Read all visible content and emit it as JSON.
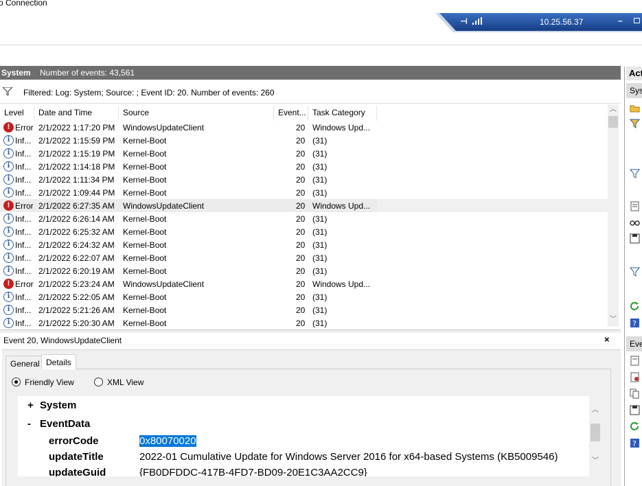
{
  "window": {
    "title": "o Connection"
  },
  "rdp_bar": {
    "ip": "10.25.56.37",
    "pin_icon": "pin-icon",
    "signal_icon": "signal-icon",
    "min_label": "–"
  },
  "log_pane": {
    "log_name": "System",
    "event_count": "Number of events: 43,561",
    "filter_text": "Filtered: Log: System; Source: ; Event ID: 20. Number of events: 260"
  },
  "columns": [
    "Level",
    "Date and Time",
    "Source",
    "Event...",
    "Task Category"
  ],
  "events": [
    {
      "level": "Error",
      "icon": "error",
      "datetime": "2/1/2022 1:17:20 PM",
      "source": "WindowsUpdateClient",
      "event_id": "20",
      "category": "Windows Upd..."
    },
    {
      "level": "Inf...",
      "icon": "info",
      "datetime": "2/1/2022 1:15:59 PM",
      "source": "Kernel-Boot",
      "event_id": "20",
      "category": "(31)"
    },
    {
      "level": "Inf...",
      "icon": "info",
      "datetime": "2/1/2022 1:15:19 PM",
      "source": "Kernel-Boot",
      "event_id": "20",
      "category": "(31)"
    },
    {
      "level": "Inf...",
      "icon": "info",
      "datetime": "2/1/2022 1:14:18 PM",
      "source": "Kernel-Boot",
      "event_id": "20",
      "category": "(31)"
    },
    {
      "level": "Inf...",
      "icon": "info",
      "datetime": "2/1/2022 1:11:34 PM",
      "source": "Kernel-Boot",
      "event_id": "20",
      "category": "(31)"
    },
    {
      "level": "Inf...",
      "icon": "info",
      "datetime": "2/1/2022 1:09:44 PM",
      "source": "Kernel-Boot",
      "event_id": "20",
      "category": "(31)"
    },
    {
      "level": "Error",
      "icon": "error",
      "datetime": "2/1/2022 6:27:35 AM",
      "source": "WindowsUpdateClient",
      "event_id": "20",
      "category": "Windows Upd...",
      "selected": true
    },
    {
      "level": "Inf...",
      "icon": "info",
      "datetime": "2/1/2022 6:26:14 AM",
      "source": "Kernel-Boot",
      "event_id": "20",
      "category": "(31)"
    },
    {
      "level": "Inf...",
      "icon": "info",
      "datetime": "2/1/2022 6:25:32 AM",
      "source": "Kernel-Boot",
      "event_id": "20",
      "category": "(31)"
    },
    {
      "level": "Inf...",
      "icon": "info",
      "datetime": "2/1/2022 6:24:32 AM",
      "source": "Kernel-Boot",
      "event_id": "20",
      "category": "(31)"
    },
    {
      "level": "Inf...",
      "icon": "info",
      "datetime": "2/1/2022 6:22:07 AM",
      "source": "Kernel-Boot",
      "event_id": "20",
      "category": "(31)"
    },
    {
      "level": "Inf...",
      "icon": "info",
      "datetime": "2/1/2022 6:20:19 AM",
      "source": "Kernel-Boot",
      "event_id": "20",
      "category": "(31)"
    },
    {
      "level": "Error",
      "icon": "error",
      "datetime": "2/1/2022 5:23:24 AM",
      "source": "WindowsUpdateClient",
      "event_id": "20",
      "category": "Windows Upd..."
    },
    {
      "level": "Inf...",
      "icon": "info",
      "datetime": "2/1/2022 5:22:05 AM",
      "source": "Kernel-Boot",
      "event_id": "20",
      "category": "(31)"
    },
    {
      "level": "Inf...",
      "icon": "info",
      "datetime": "2/1/2022 5:21:26 AM",
      "source": "Kernel-Boot",
      "event_id": "20",
      "category": "(31)"
    },
    {
      "level": "Inf...",
      "icon": "info",
      "datetime": "2/1/2022 5:20:30 AM",
      "source": "Kernel-Boot",
      "event_id": "20",
      "category": "(31)"
    }
  ],
  "detail": {
    "title": "Event 20, WindowsUpdateClient",
    "close_label": "×",
    "tabs": [
      "General",
      "Details"
    ],
    "active_tab": "Details",
    "views": [
      "Friendly View",
      "XML View"
    ],
    "selected_view": "Friendly View",
    "tree": {
      "system_toggle": "+",
      "system_label": "System",
      "eventdata_toggle": "-",
      "eventdata_label": "EventData",
      "fields": [
        {
          "name": "errorCode",
          "value": "0x80070020",
          "highlighted": true
        },
        {
          "name": "updateTitle",
          "value": "2022-01 Cumulative Update for Windows Server 2016 for x64-based Systems (KB5009546)"
        },
        {
          "name": "updateGuid",
          "value": "{FB0DFDDC-417B-4FD7-BD09-20E1C3AA2CC9}"
        }
      ]
    }
  },
  "actions_pane": {
    "title": "Act",
    "section1": "Sys",
    "section2": "Eve"
  },
  "colors": {
    "error": "#c81e1e",
    "info": "#2e5b9a",
    "header_bg": "#6e6e6e",
    "rdp_bar": "#1f4f9a",
    "selection": "#0078d7"
  }
}
